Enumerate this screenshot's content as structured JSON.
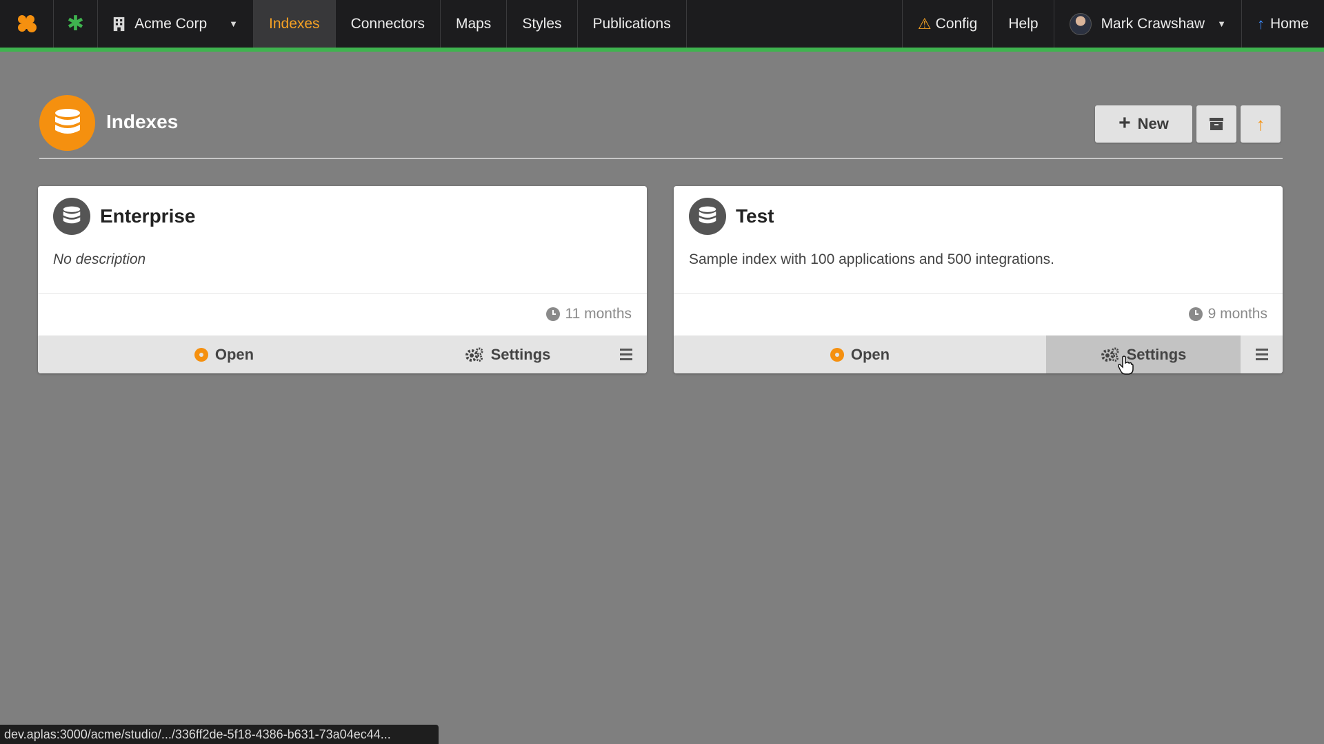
{
  "nav": {
    "org": "Acme Corp",
    "items": [
      {
        "label": "Indexes",
        "active": true
      },
      {
        "label": "Connectors"
      },
      {
        "label": "Maps"
      },
      {
        "label": "Styles"
      },
      {
        "label": "Publications"
      }
    ],
    "config_label": "Config",
    "help_label": "Help",
    "user_name": "Mark Crawshaw",
    "home_label": "Home"
  },
  "page": {
    "title": "Indexes",
    "new_label": "New"
  },
  "cards": [
    {
      "title": "Enterprise",
      "description": "No description",
      "time": "11 months",
      "open_label": "Open",
      "settings_label": "Settings"
    },
    {
      "title": "Test",
      "description": "Sample index with 100 applications and 500 integrations.",
      "time": "9 months",
      "open_label": "Open",
      "settings_label": "Settings"
    }
  ],
  "status_url": "dev.aplas:3000/acme/studio/.../336ff2de-5f18-4386-b631-73a04ec44...",
  "colors": {
    "accent": "#f5900f",
    "nav_bg": "#1c1c1e",
    "nav_border": "#3fb34f",
    "page_bg": "#7f7f7f"
  },
  "icons": {
    "logo": "app-logo-icon",
    "star": "asterisk-icon",
    "org": "building-icon",
    "warning": "warning-icon",
    "home": "arrow-up-icon",
    "page": "database-icon",
    "archive": "archive-icon",
    "clock": "clock-icon",
    "gear": "gears-icon",
    "menu": "hamburger-icon"
  }
}
